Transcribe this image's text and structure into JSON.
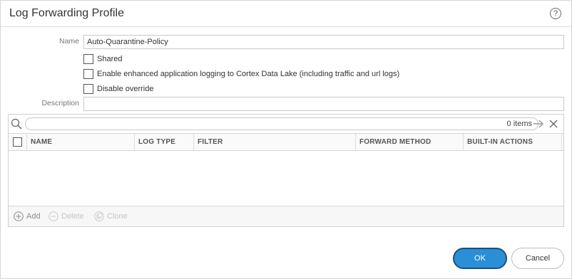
{
  "dialog": {
    "title": "Log Forwarding Profile",
    "help_glyph": "?"
  },
  "form": {
    "name_label": "Name",
    "name_value": "Auto-Quarantine-Policy",
    "shared_label": "Shared",
    "shared_checked": false,
    "enhanced_logging_label": "Enable enhanced application logging to Cortex Data Lake (including traffic and url logs)",
    "enhanced_logging_checked": false,
    "disable_override_label": "Disable override",
    "disable_override_checked": false,
    "description_label": "Description",
    "description_value": ""
  },
  "grid": {
    "search_placeholder": "",
    "items_count": "0 items",
    "columns": [
      "NAME",
      "LOG TYPE",
      "FILTER",
      "FORWARD METHOD",
      "BUILT-IN ACTIONS"
    ],
    "rows": [],
    "footer": {
      "add_label": "Add",
      "delete_label": "Delete",
      "clone_label": "Clone"
    }
  },
  "buttons": {
    "ok_label": "OK",
    "cancel_label": "Cancel"
  },
  "colors": {
    "ok_bg": "#2a8fd6",
    "ok_border": "#1a4f80"
  },
  "icons": [
    "help-icon",
    "search-icon",
    "arrow-right-icon",
    "clear-icon",
    "add-icon",
    "delete-icon",
    "clone-icon"
  ]
}
